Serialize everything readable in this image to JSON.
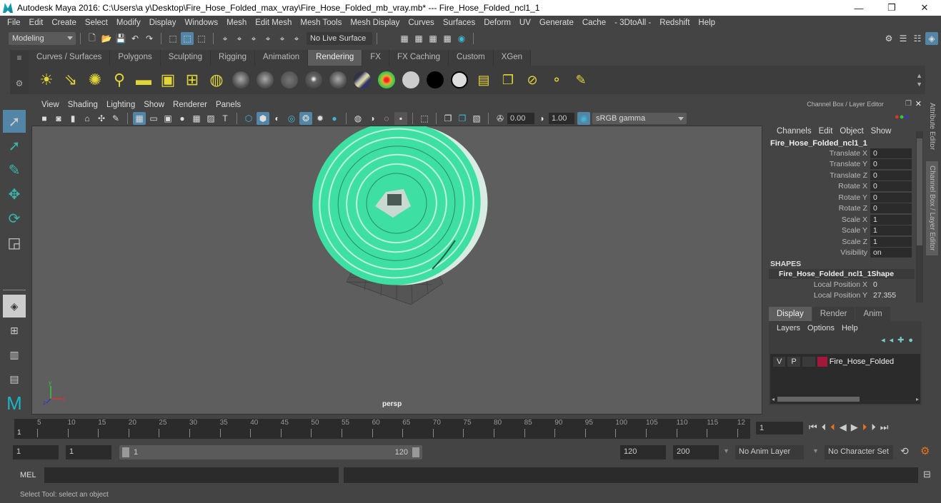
{
  "window": {
    "title": "Autodesk Maya 2016: C:\\Users\\a y\\Desktop\\Fire_Hose_Folded_max_vray\\Fire_Hose_Folded_mb_vray.mb*   ---   Fire_Hose_Folded_ncl1_1",
    "controls": {
      "minimize": "—",
      "maximize": "❐",
      "close": "✕"
    }
  },
  "menubar": [
    "File",
    "Edit",
    "Create",
    "Select",
    "Modify",
    "Display",
    "Windows",
    "Mesh",
    "Edit Mesh",
    "Mesh Tools",
    "Mesh Display",
    "Curves",
    "Surfaces",
    "Deform",
    "UV",
    "Generate",
    "Cache",
    "- 3DtoAll -",
    "Redshift",
    "Help"
  ],
  "statusline": {
    "menuset": "Modeling",
    "live_surface": "No Live Surface"
  },
  "shelf": {
    "tabs": [
      "Curves / Surfaces",
      "Polygons",
      "Sculpting",
      "Rigging",
      "Animation",
      "Rendering",
      "FX",
      "FX Caching",
      "Custom",
      "XGen"
    ],
    "active_tab": "Rendering",
    "icons": [
      "ambient-light-icon",
      "directional-light-icon",
      "point-light-icon",
      "spot-light-icon",
      "area-light-icon",
      "volume-light-icon",
      "camera-aim-icon",
      "light-editor-icon",
      "lambert-icon",
      "blinn-icon",
      "phong-icon",
      "phong-e-icon",
      "anisotropic-icon",
      "ramp-shader-icon",
      "heat-map-icon",
      "white-sphere-icon",
      "black-sphere-icon",
      "outline-sphere-icon",
      "hypershade-icon",
      "render-layer-icon",
      "render-settings-icon",
      "ipr-settings-icon",
      "paint-tool-icon"
    ]
  },
  "viewport": {
    "menu": [
      "View",
      "Shading",
      "Lighting",
      "Show",
      "Renderer",
      "Panels"
    ],
    "exposure": "0.00",
    "gamma": "1.00",
    "color_space": "sRGB gamma",
    "camera": "persp",
    "axis": {
      "x": "x",
      "y": "y",
      "z": "z"
    }
  },
  "channel_box": {
    "title": "Channel Box / Layer Editor",
    "menu": [
      "Channels",
      "Edit",
      "Object",
      "Show"
    ],
    "object": "Fire_Hose_Folded_ncl1_1",
    "attributes": [
      {
        "label": "Translate X",
        "value": "0"
      },
      {
        "label": "Translate Y",
        "value": "0"
      },
      {
        "label": "Translate Z",
        "value": "0"
      },
      {
        "label": "Rotate X",
        "value": "0"
      },
      {
        "label": "Rotate Y",
        "value": "0"
      },
      {
        "label": "Rotate Z",
        "value": "0"
      },
      {
        "label": "Scale X",
        "value": "1"
      },
      {
        "label": "Scale Y",
        "value": "1"
      },
      {
        "label": "Scale Z",
        "value": "1"
      },
      {
        "label": "Visibility",
        "value": "on"
      }
    ],
    "shapes_header": "SHAPES",
    "shape_name": "Fire_Hose_Folded_ncl1_1Shape",
    "shape_attributes": [
      {
        "label": "Local Position X",
        "value": "0"
      },
      {
        "label": "Local Position Y",
        "value": "27.355"
      }
    ]
  },
  "side_tabs": [
    "Attribute Editor",
    "Channel Box / Layer Editor"
  ],
  "layer_editor": {
    "tabs": [
      "Display",
      "Render",
      "Anim"
    ],
    "active_tab": "Display",
    "menu": [
      "Layers",
      "Options",
      "Help"
    ],
    "layers": [
      {
        "v": "V",
        "p": "P",
        "color": "#a3173a",
        "name": "Fire_Hose_Folded"
      }
    ]
  },
  "timeline": {
    "ticks": [
      "5",
      "10",
      "15",
      "20",
      "25",
      "30",
      "35",
      "40",
      "45",
      "50",
      "55",
      "60",
      "65",
      "70",
      "75",
      "80",
      "85",
      "90",
      "95",
      "100",
      "105",
      "110",
      "115",
      "12"
    ],
    "current_frame_marker": "1",
    "current_frame": "1"
  },
  "range": {
    "start": "1",
    "playback_start": "1",
    "slider_start": "1",
    "slider_end": "120",
    "playback_end": "120",
    "end": "200",
    "anim_layer": "No Anim Layer",
    "character_set": "No Character Set"
  },
  "command_line": {
    "label": "MEL"
  },
  "help_line": "Select Tool: select an object"
}
